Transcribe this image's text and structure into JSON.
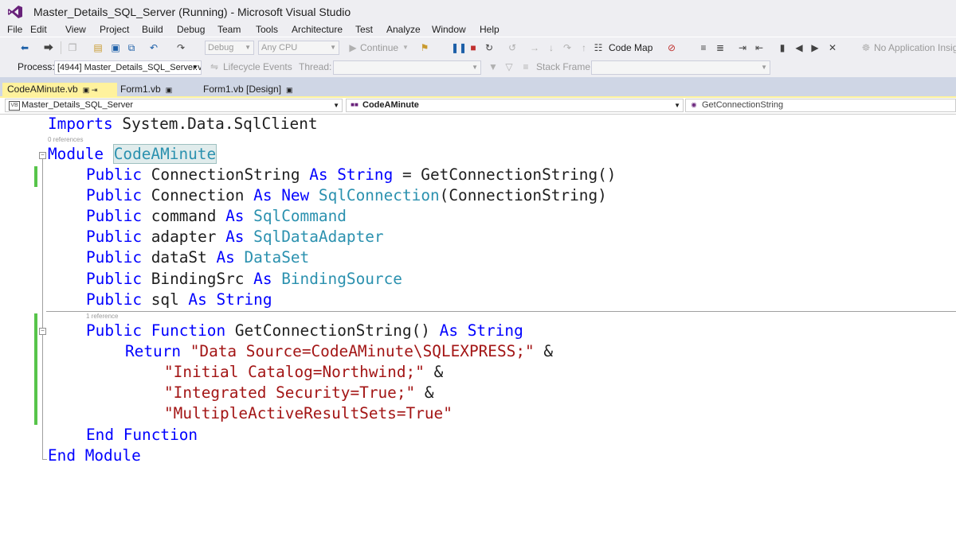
{
  "window": {
    "title": "Master_Details_SQL_Server (Running) - Microsoft Visual Studio"
  },
  "menu": [
    "File",
    "Edit",
    "View",
    "Project",
    "Build",
    "Debug",
    "Team",
    "Tools",
    "Architecture",
    "Test",
    "Analyze",
    "Window",
    "Help"
  ],
  "toolbar1": {
    "config": "Debug",
    "platform": "Any CPU",
    "continue": "Continue",
    "code_map": "Code Map",
    "app_insights": "No Application Insig"
  },
  "toolbar2": {
    "process_label": "Process:",
    "process_value": "[4944] Master_Details_SQL_Server.v",
    "lifecycle": "Lifecycle Events",
    "thread_label": "Thread:",
    "stack_label": "Stack Frame:"
  },
  "tabs": [
    {
      "label": "CodeAMinute.vb",
      "pin": "▣ ⇥"
    },
    {
      "label": "Form1.vb",
      "pin": "▣"
    },
    {
      "label": "Form1.vb [Design]",
      "pin": "▣"
    }
  ],
  "navbar": {
    "project": "Master_Details_SQL_Server",
    "type": "CodeAMinute",
    "member": "GetConnectionString"
  },
  "code": {
    "imports": [
      "Imports",
      " System.Data.SqlClient"
    ],
    "refs0": "0 references",
    "module_kw": "Module",
    "module_name": "CodeAMinute",
    "l1": [
      "Public",
      " ConnectionString ",
      "As",
      " ",
      "String",
      " = GetConnectionString()"
    ],
    "l2": [
      "Public",
      " Connection ",
      "As",
      " ",
      "New",
      " ",
      "SqlConnection",
      "(ConnectionString)"
    ],
    "l3": [
      "Public",
      " command ",
      "As",
      " ",
      "SqlCommand"
    ],
    "l4": [
      "Public",
      " adapter ",
      "As",
      " ",
      "SqlDataAdapter"
    ],
    "l5": [
      "Public",
      " dataSt ",
      "As",
      " ",
      "DataSet"
    ],
    "l6": [
      "Public",
      " BindingSrc ",
      "As",
      " ",
      "BindingSource"
    ],
    "l7": [
      "Public",
      " sql ",
      "As",
      " ",
      "String"
    ],
    "refs1": "1 reference",
    "f1": [
      "Public",
      " ",
      "Function",
      " GetConnectionString() ",
      "As",
      " ",
      "String"
    ],
    "f2": [
      "Return",
      " ",
      "\"Data Source=CodeAMinute\\SQLEXPRESS;\"",
      " &"
    ],
    "f3": [
      "\"Initial Catalog=Northwind;\"",
      " &"
    ],
    "f4": [
      "\"Integrated Security=True;\"",
      " &"
    ],
    "f5": [
      "\"MultipleActiveResultSets=True\""
    ],
    "end_fn": "End Function",
    "end_mod": "End Module"
  },
  "colors": {
    "keyword": "#0000ff",
    "type": "#2b91af",
    "string": "#a31515",
    "tab_active": "#fff29d",
    "change_bar": "#57c44a"
  }
}
